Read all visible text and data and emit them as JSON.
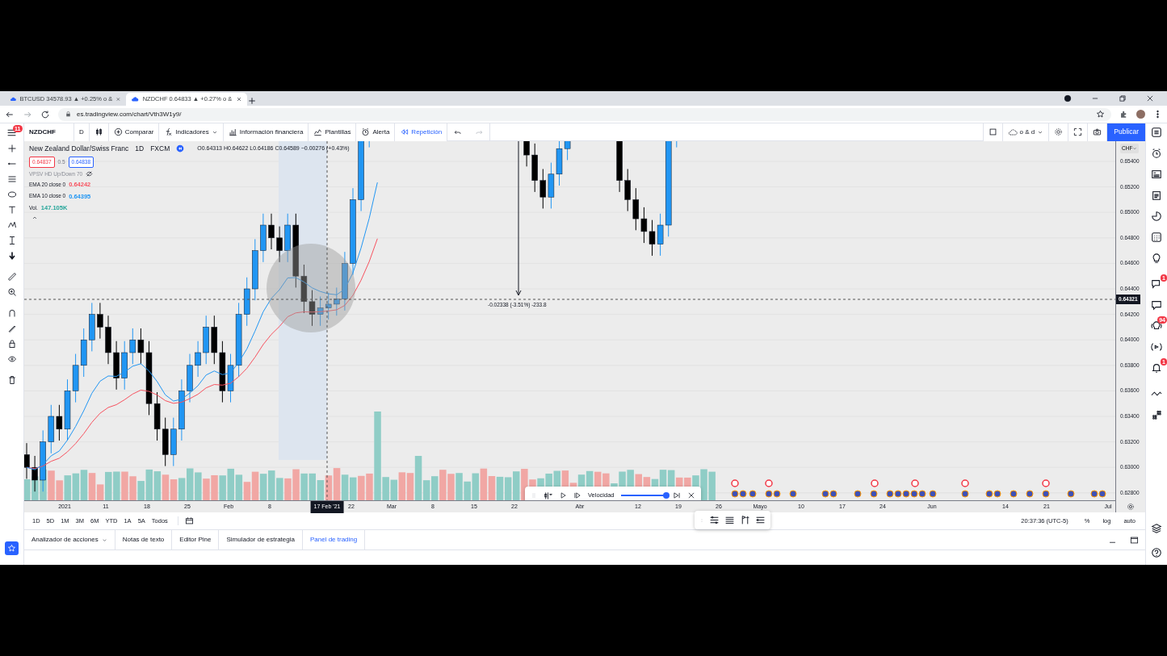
{
  "browser": {
    "tabs": [
      {
        "title": "BTCUSD 34578.93 ▲ +0.25% o &",
        "selected": false
      },
      {
        "title": "NZDCHF 0.64833 ▲ +0.27% o &",
        "selected": true
      }
    ],
    "address": "es.tradingview.com/chart/Vth3W1y9/"
  },
  "toolbar": {
    "menu_badge": "11",
    "symbol": "NZDCHF",
    "interval": "D",
    "items": [
      {
        "kind": "compare",
        "label": "Comparar",
        "active": false
      },
      {
        "kind": "indicators",
        "label": "Indicadores",
        "active": false
      },
      {
        "kind": "financials",
        "label": "Información financiera",
        "active": false
      },
      {
        "kind": "templates",
        "label": "Plantillas",
        "active": false
      },
      {
        "kind": "alert",
        "label": "Alerta",
        "active": false
      },
      {
        "kind": "replay",
        "label": "Repetición",
        "active": true
      }
    ],
    "layout_name": "o & d",
    "publish": "Publicar"
  },
  "legend": {
    "title": "New Zealand Dollar/Swiss Franc",
    "interval": "1D",
    "exchange": "FXCM",
    "ohlc": "O0.64313 H0.64622 L0.64186 C0.64589 −0.00276 (+0.43%)",
    "sell": "0.64837",
    "spread": "0.5",
    "buy": "0.64838",
    "indicators": [
      {
        "label": "VPSV HD Up/Down 70",
        "hidden": true
      },
      {
        "label": "EMA 20 close 0",
        "value": "0.64242",
        "color": "#f7525f",
        "hidden": false
      },
      {
        "label": "EMA 10 close 0",
        "value": "0.64395",
        "color": "#2196f3",
        "hidden": false
      },
      {
        "label": "Vol.",
        "value": "147.105K",
        "color": "#26a69a",
        "hidden": false
      }
    ]
  },
  "measure": "-0.02338 (-3.51%) -233.8",
  "price_axis": {
    "currency": "CHF",
    "ticks": [
      "0.65400",
      "0.65200",
      "0.65000",
      "0.64800",
      "0.64600",
      "0.64400",
      "0.64200",
      "0.64000",
      "0.63800",
      "0.63600",
      "0.63400",
      "0.63200",
      "0.63000",
      "0.62800"
    ],
    "current": "0.64321"
  },
  "time_axis": {
    "labels": [
      "2021",
      "11",
      "18",
      "25",
      "Feb",
      "8",
      "22",
      "Mar",
      "8",
      "15",
      "22",
      "Abr",
      "12",
      "19",
      "26",
      "Mayo",
      "10",
      "17",
      "24",
      "Jun",
      "14",
      "21",
      "Jul"
    ],
    "cursor": "17 Feb '21"
  },
  "replay": {
    "speed_label": "Velocidad",
    "level": 1
  },
  "ranges": [
    "1D",
    "5D",
    "1M",
    "3M",
    "6M",
    "YTD",
    "1A",
    "5A",
    "Todos"
  ],
  "status": {
    "time": "20:37:36 (UTC-5)",
    "percent": "%",
    "log": "log",
    "auto": "auto"
  },
  "bottom_tabs": [
    {
      "label": "Analizador de acciones",
      "selected": false
    },
    {
      "label": "Notas de texto",
      "selected": false
    },
    {
      "label": "Editor Pine",
      "selected": false
    },
    {
      "label": "Simulador de estrategia",
      "selected": false
    },
    {
      "label": "Panel de trading",
      "selected": true
    }
  ],
  "sidebar_badges": {
    "chat": "1",
    "streams": "94",
    "notifications": "1"
  }
}
